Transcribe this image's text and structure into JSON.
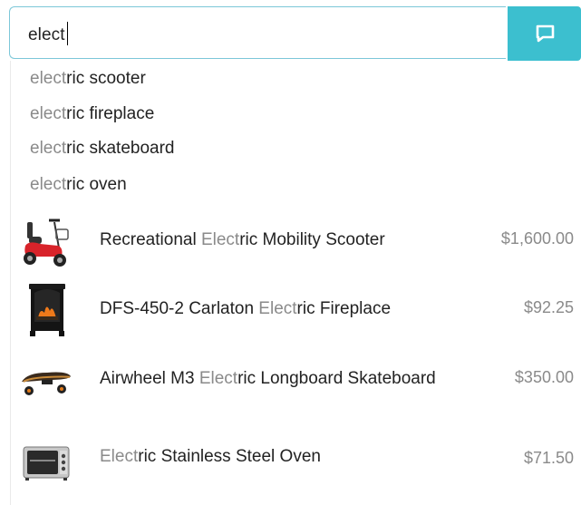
{
  "search": {
    "value": "elect",
    "button_icon": "chat-bubble-icon",
    "accent_color": "#3cbfcf"
  },
  "suggestions": [
    {
      "match": "elect",
      "rest": "ric scooter"
    },
    {
      "match": "elect",
      "rest": "ric fireplace"
    },
    {
      "match": "elect",
      "rest": "ric skateboard"
    },
    {
      "match": "elect",
      "rest": "ric oven"
    }
  ],
  "products": [
    {
      "before": "Recreational ",
      "match": "Elect",
      "after": "ric Mobility Scooter",
      "price": "$1,600.00",
      "image": "mobility-scooter"
    },
    {
      "before": "DFS-450-2 Carlaton ",
      "match": "Elect",
      "after": "ric Fireplace",
      "price": "$92.25",
      "image": "electric-fireplace"
    },
    {
      "before": "Airwheel M3 ",
      "match": "Elect",
      "after": "ric Longboard Skateboard",
      "price": "$350.00",
      "image": "electric-skateboard"
    },
    {
      "before": "",
      "match": "Elect",
      "after": "ric Stainless Steel Oven",
      "price": "$71.50",
      "image": "toaster-oven"
    }
  ]
}
